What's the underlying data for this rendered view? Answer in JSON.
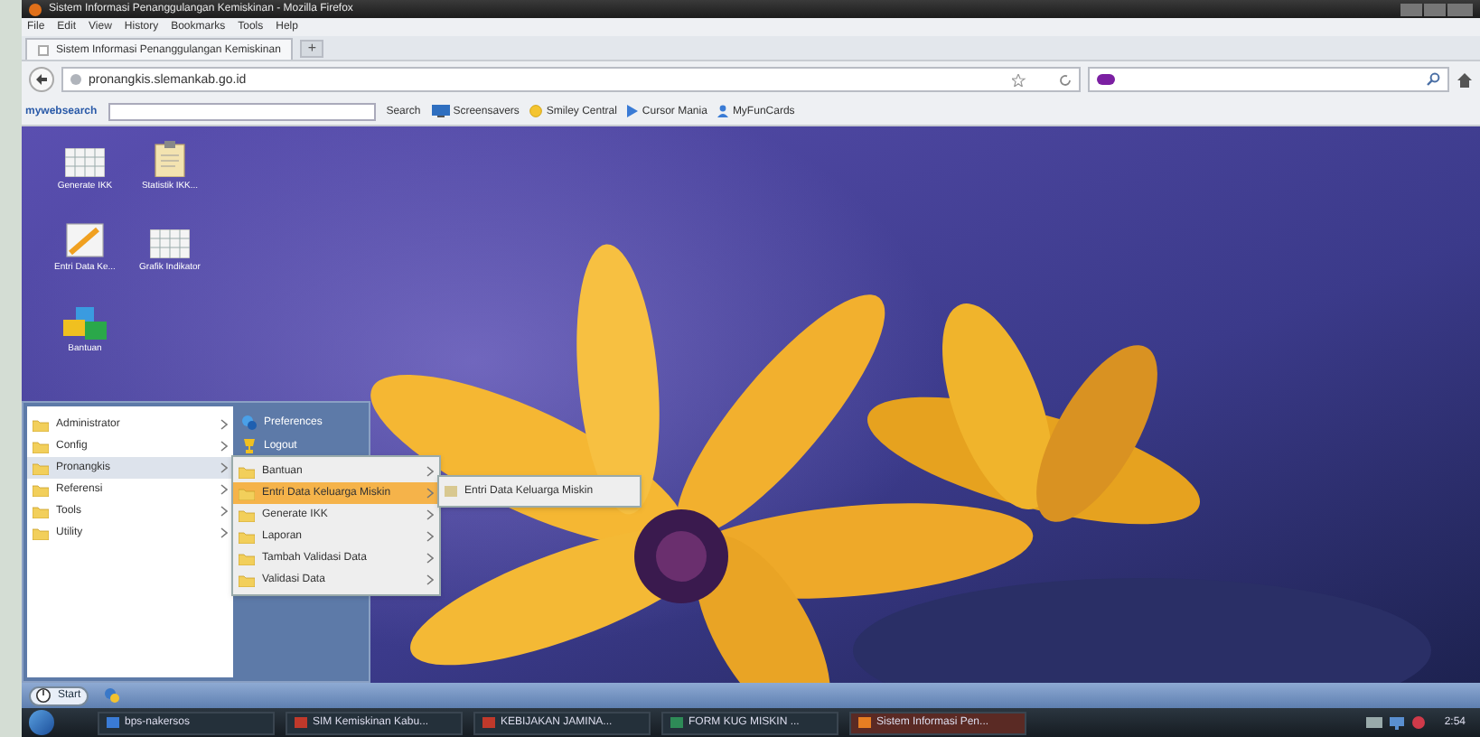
{
  "window": {
    "title": "Sistem Informasi Penanggulangan Kemiskinan - Mozilla Firefox"
  },
  "menu_bar": [
    "File",
    "Edit",
    "View",
    "History",
    "Bookmarks",
    "Tools",
    "Help"
  ],
  "tabs": [
    {
      "label": "Sistem Informasi Penanggulangan Kemiskinan",
      "selected": true
    }
  ],
  "new_tab": "+",
  "address_bar": {
    "url": "pronangkis.slemankab.go.id"
  },
  "toolbar": {
    "brand": "mywebsearch",
    "search_button": "Search",
    "links": [
      {
        "label": "Screensavers",
        "kind": "monitor"
      },
      {
        "label": "Smiley Central",
        "kind": "smiley"
      },
      {
        "label": "Cursor Mania",
        "kind": "cursor"
      },
      {
        "label": "MyFunCards",
        "kind": "person"
      }
    ]
  },
  "desktop_icons": [
    {
      "label": "Generate IKK",
      "kind": "table"
    },
    {
      "label": "Statistik IKK...",
      "kind": "clipboard"
    },
    {
      "label": "Entri Data Ke...",
      "kind": "pencil"
    },
    {
      "label": "Grafik Indikator",
      "kind": "table"
    },
    {
      "label": "Bantuan",
      "kind": "blocks"
    }
  ],
  "start_menu": {
    "items": [
      {
        "label": "Administrator",
        "selected": false
      },
      {
        "label": "Config",
        "selected": false
      },
      {
        "label": "Pronangkis",
        "selected": true
      },
      {
        "label": "Referensi",
        "selected": false
      },
      {
        "label": "Tools",
        "selected": false
      },
      {
        "label": "Utility",
        "selected": false
      }
    ],
    "side_items": [
      {
        "label": "Preferences",
        "kind": "preferences"
      },
      {
        "label": "Logout",
        "kind": "logout"
      }
    ]
  },
  "submenu": {
    "items": [
      {
        "label": "Bantuan",
        "selected": false
      },
      {
        "label": "Entri Data Keluarga Miskin",
        "selected": true
      },
      {
        "label": "Generate IKK",
        "selected": false
      },
      {
        "label": "Laporan",
        "selected": false
      },
      {
        "label": "Tambah Validasi Data",
        "selected": false
      },
      {
        "label": "Validasi Data",
        "selected": false
      }
    ]
  },
  "flyout": {
    "items": [
      "Entri Data Keluarga Miskin"
    ]
  },
  "start_button": "Start",
  "taskbar": {
    "items": [
      {
        "label": "bps-nakersos",
        "selected": false
      },
      {
        "label": "SIM Kemiskinan Kabu...",
        "selected": false
      },
      {
        "label": "KEBIJAKAN JAMINA...",
        "selected": false
      },
      {
        "label": "FORM KUG MISKIN ...",
        "selected": false
      },
      {
        "label": "Sistem Informasi Pen...",
        "selected": true
      }
    ],
    "clock": "2:54"
  }
}
